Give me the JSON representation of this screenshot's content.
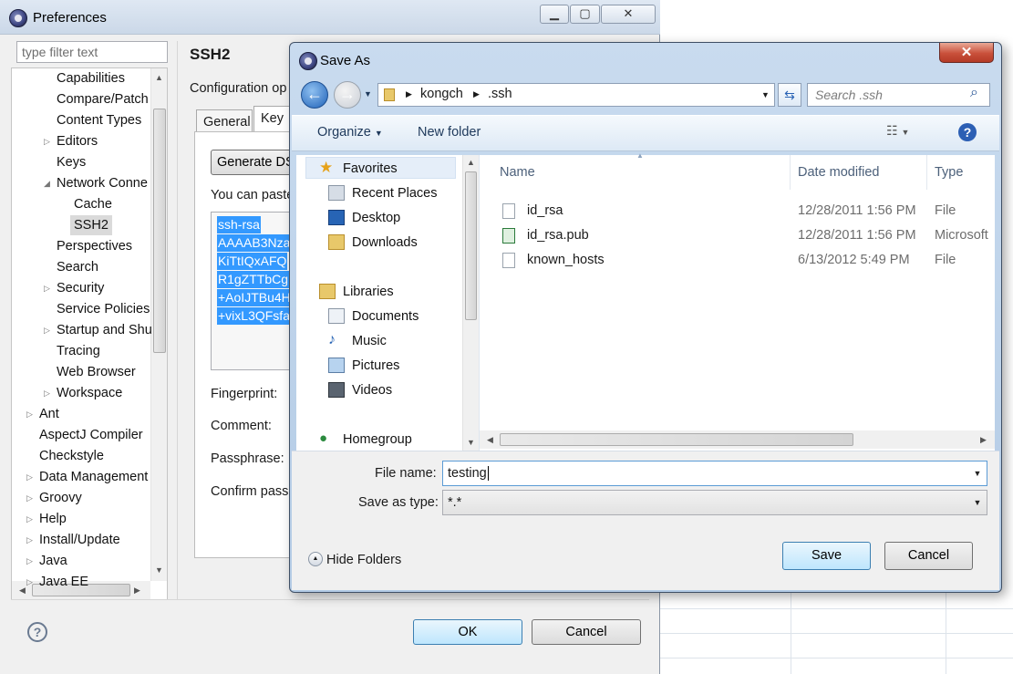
{
  "preferences": {
    "title": "Preferences",
    "filter_placeholder": "type filter text",
    "tree": [
      {
        "label": "Capabilities",
        "level": 2,
        "twisty": ""
      },
      {
        "label": "Compare/Patch",
        "level": 2,
        "twisty": ""
      },
      {
        "label": "Content Types",
        "level": 2,
        "twisty": ""
      },
      {
        "label": "Editors",
        "level": 2,
        "twisty": "▷"
      },
      {
        "label": "Keys",
        "level": 2,
        "twisty": ""
      },
      {
        "label": "Network Conne",
        "level": 2,
        "twisty": "◢"
      },
      {
        "label": "Cache",
        "level": 3,
        "twisty": ""
      },
      {
        "label": "SSH2",
        "level": 3,
        "twisty": "",
        "selected": true
      },
      {
        "label": "Perspectives",
        "level": 2,
        "twisty": ""
      },
      {
        "label": "Search",
        "level": 2,
        "twisty": ""
      },
      {
        "label": "Security",
        "level": 2,
        "twisty": "▷"
      },
      {
        "label": "Service Policies",
        "level": 2,
        "twisty": ""
      },
      {
        "label": "Startup and Shu",
        "level": 2,
        "twisty": "▷"
      },
      {
        "label": "Tracing",
        "level": 2,
        "twisty": ""
      },
      {
        "label": "Web Browser",
        "level": 2,
        "twisty": ""
      },
      {
        "label": "Workspace",
        "level": 2,
        "twisty": "▷"
      },
      {
        "label": "Ant",
        "level": 1,
        "twisty": "▷"
      },
      {
        "label": "AspectJ Compiler",
        "level": 1,
        "twisty": ""
      },
      {
        "label": "Checkstyle",
        "level": 1,
        "twisty": ""
      },
      {
        "label": "Data Management",
        "level": 1,
        "twisty": "▷"
      },
      {
        "label": "Groovy",
        "level": 1,
        "twisty": "▷"
      },
      {
        "label": "Help",
        "level": 1,
        "twisty": "▷"
      },
      {
        "label": "Install/Update",
        "level": 1,
        "twisty": "▷"
      },
      {
        "label": "Java",
        "level": 1,
        "twisty": "▷"
      },
      {
        "label": "Java EE",
        "level": 1,
        "twisty": "▷"
      }
    ],
    "page_title": "SSH2",
    "page_subtitle": "Configuration op",
    "tabs": [
      "General",
      "Key"
    ],
    "generate_button": "Generate DS",
    "paste_label": "You can paste",
    "key_lines": [
      "ssh-rsa",
      "AAAAB3Nza",
      "KiTtIQxAFQ",
      "R1gZTTbCg",
      "+AoIJTBu4H",
      "+vixL3QFsfa"
    ],
    "fields": {
      "fingerprint": "Fingerprint:",
      "comment": "Comment:",
      "passphrase": "Passphrase:",
      "confirm": "Confirm pass"
    },
    "ok": "OK",
    "cancel": "Cancel",
    "help_glyph": "?"
  },
  "save_as": {
    "title": "Save As",
    "breadcrumb": [
      "kongch",
      ".ssh"
    ],
    "search_placeholder": "Search .ssh",
    "toolbar": {
      "organize": "Organize",
      "new_folder": "New folder"
    },
    "nav": {
      "favorites": "Favorites",
      "favorites_items": [
        "Recent Places",
        "Desktop",
        "Downloads"
      ],
      "libraries": "Libraries",
      "libraries_items": [
        "Documents",
        "Music",
        "Pictures",
        "Videos"
      ],
      "homegroup": "Homegroup"
    },
    "columns": [
      "Name",
      "Date modified",
      "Type"
    ],
    "files": [
      {
        "name": "id_rsa",
        "modified": "12/28/2011 1:56 PM",
        "type": "File"
      },
      {
        "name": "id_rsa.pub",
        "modified": "12/28/2011 1:56 PM",
        "type": "Microsoft"
      },
      {
        "name": "known_hosts",
        "modified": "6/13/2012 5:49 PM",
        "type": "File"
      }
    ],
    "file_name_label": "File name:",
    "file_name_value": "testing",
    "save_type_label": "Save as type:",
    "save_type_value": "*.*",
    "hide_folders": "Hide Folders",
    "save": "Save",
    "cancel": "Cancel"
  },
  "colors": {
    "accent": "#3399ff",
    "close": "#c9503b"
  }
}
